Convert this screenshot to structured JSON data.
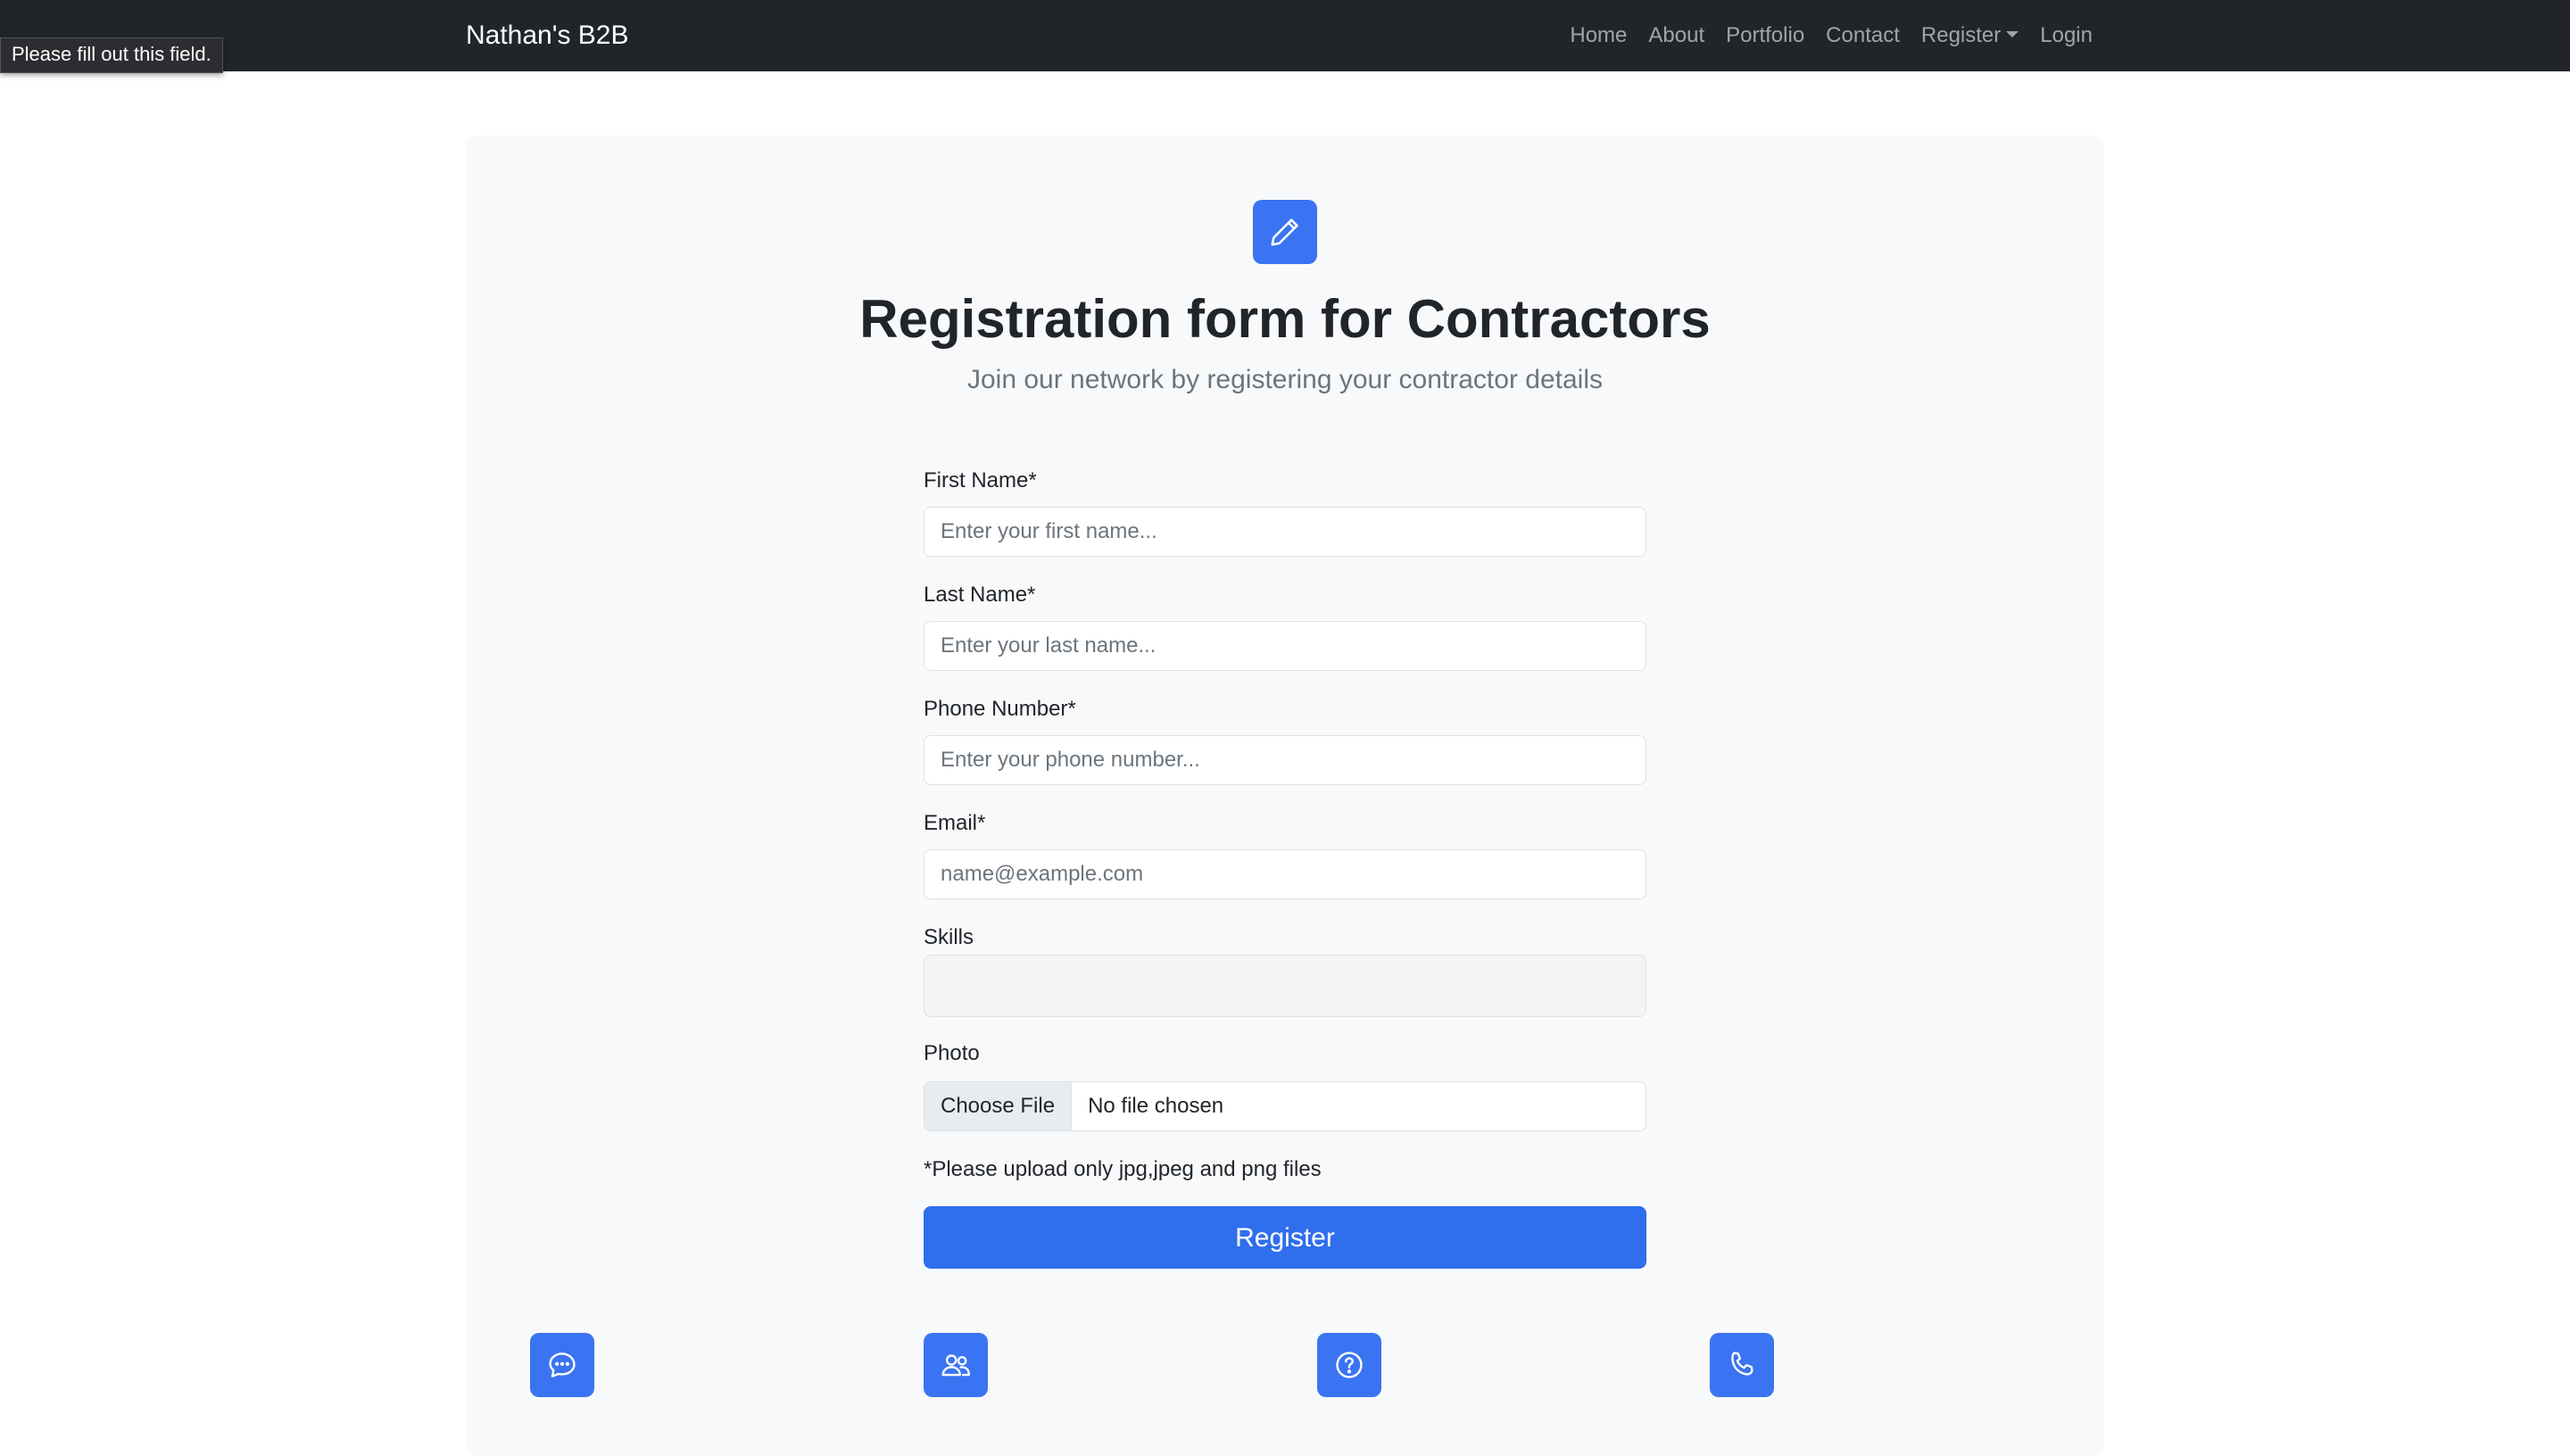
{
  "navbar": {
    "brand": "Nathan's B2B",
    "links": [
      "Home",
      "About",
      "Portfolio",
      "Contact"
    ],
    "register_label": "Register",
    "login_label": "Login"
  },
  "tooltip": "Please fill out this field.",
  "header": {
    "icon": "pencil-icon",
    "title": "Registration form for Contractors",
    "subtitle": "Join our network by registering your contractor details"
  },
  "form": {
    "first_name": {
      "label": "First Name*",
      "placeholder": "Enter your first name...",
      "value": ""
    },
    "last_name": {
      "label": "Last Name*",
      "placeholder": "Enter your last name...",
      "value": ""
    },
    "phone": {
      "label": "Phone Number*",
      "placeholder": "Enter your phone number...",
      "value": ""
    },
    "email": {
      "label": "Email*",
      "placeholder": "name@example.com",
      "value": ""
    },
    "skills": {
      "label": "Skills",
      "value": ""
    },
    "photo": {
      "label": "Photo",
      "button": "Choose File",
      "status": "No file chosen"
    },
    "note": "*Please upload only jpg,jpeg and png files",
    "submit_label": "Register"
  },
  "features": {
    "icons": [
      "chat-icon",
      "people-icon",
      "question-icon",
      "phone-icon"
    ]
  },
  "colors": {
    "navbar_bg": "#212529",
    "accent": "#2f6eed",
    "card_bg": "#f8f9fa"
  }
}
